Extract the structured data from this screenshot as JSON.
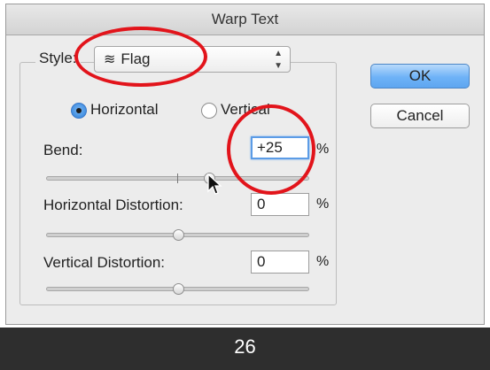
{
  "window": {
    "title": "Warp Text"
  },
  "style": {
    "label": "Style:",
    "selected": "Flag",
    "icon": "flag-warp-icon"
  },
  "orientation": {
    "horizontal": "Horizontal",
    "vertical": "Vertical",
    "selected": "Horizontal"
  },
  "bend": {
    "label": "Bend:",
    "value": "+25",
    "unit": "%",
    "slider_value": 25
  },
  "horizontal_distortion": {
    "label": "Horizontal Distortion:",
    "value": "0",
    "unit": "%",
    "slider_value": 0
  },
  "vertical_distortion": {
    "label": "Vertical Distortion:",
    "value": "0",
    "unit": "%",
    "slider_value": 0
  },
  "buttons": {
    "ok": "OK",
    "cancel": "Cancel"
  },
  "caption": {
    "page": "26"
  },
  "colors": {
    "annotation": "#e2141b",
    "default_button": "#6eb2f7",
    "focus_ring": "#5c9ce6",
    "caption_bg": "#2e2e2e"
  }
}
